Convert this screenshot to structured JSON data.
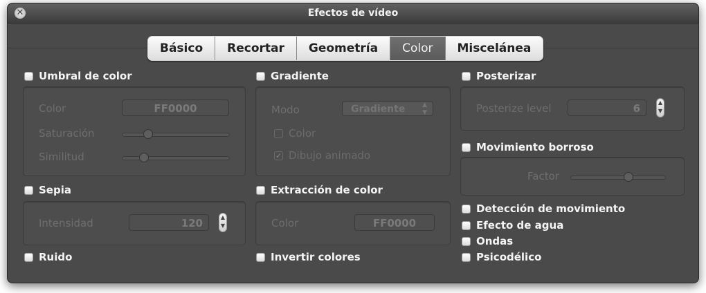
{
  "window": {
    "title": "Efectos de vídeo"
  },
  "tabs": [
    {
      "label": "Básico"
    },
    {
      "label": "Recortar"
    },
    {
      "label": "Geometría"
    },
    {
      "label": "Color"
    },
    {
      "label": "Miscelánea"
    }
  ],
  "active_tab": "Color",
  "umbral": {
    "title": "Umbral de color",
    "color_label": "Color",
    "color_value": "FF0000",
    "saturacion_label": "Saturación",
    "saturacion_level": 0.25,
    "similitud_label": "Similitud",
    "similitud_level": 0.2
  },
  "sepia": {
    "title": "Sepia",
    "intensidad_label": "Intensidad",
    "intensidad_value": "120"
  },
  "ruido": {
    "title": "Ruido"
  },
  "gradiente": {
    "title": "Gradiente",
    "modo_label": "Modo",
    "modo_value": "Gradiente",
    "color_option": "Color",
    "dibujo_option": "Dibujo animado"
  },
  "extraccion": {
    "title": "Extracción de color",
    "color_label": "Color",
    "color_value": "FF0000"
  },
  "invertir": {
    "title": "Invertir colores"
  },
  "posterizar": {
    "title": "Posterizar",
    "level_label": "Posterize level",
    "level_value": "6"
  },
  "movimiento": {
    "title": "Movimiento borroso",
    "factor_label": "Factor",
    "factor_level": 0.6
  },
  "deteccion": {
    "title": "Detección de movimiento"
  },
  "agua": {
    "title": "Efecto de agua"
  },
  "ondas": {
    "title": "Ondas"
  },
  "psicodelico": {
    "title": "Psicodélico"
  }
}
